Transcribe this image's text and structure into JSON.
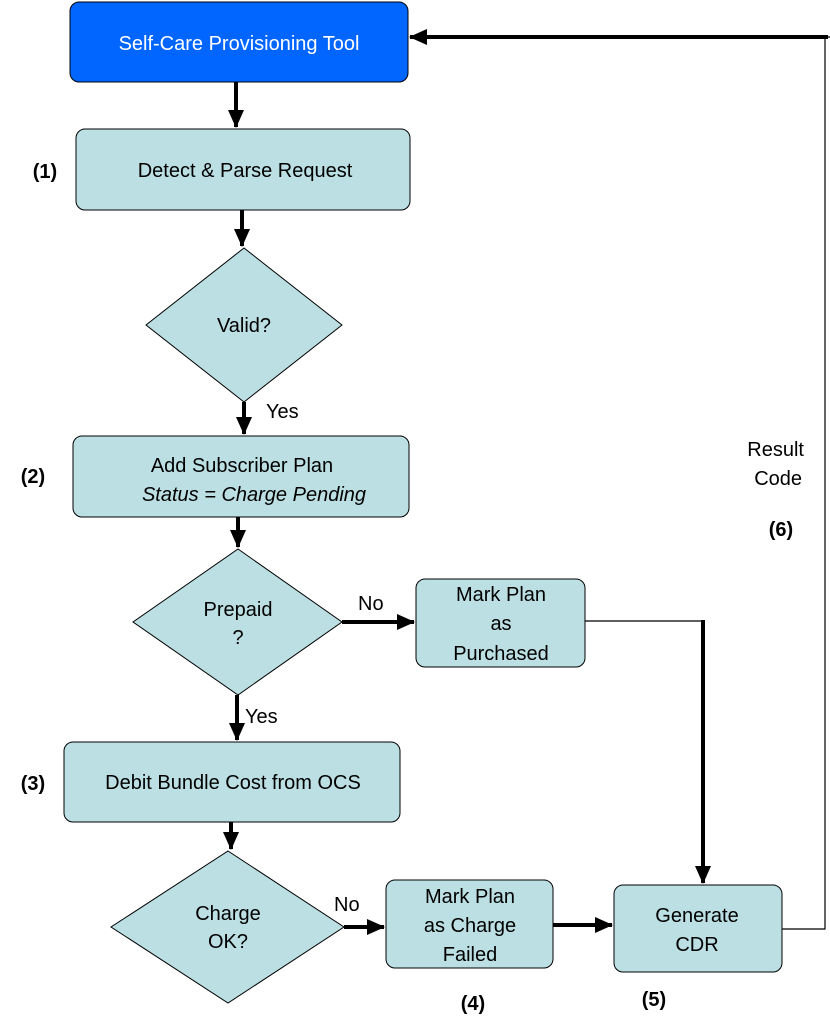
{
  "diagram": {
    "colors": {
      "start_fill": "#0066FF",
      "node_fill": "#BBDFE3",
      "line": "#000000",
      "text": "#000000",
      "start_text": "#FFFFFF"
    },
    "nodes": {
      "start": {
        "label": "Self-Care Provisioning Tool"
      },
      "detect": {
        "label": "Detect & Parse Request",
        "step": "(1)"
      },
      "valid": {
        "label": "Valid?"
      },
      "add_plan": {
        "line1": "Add Subscriber Plan",
        "line2": "Status = Charge Pending",
        "step": "(2)"
      },
      "prepaid": {
        "line1": "Prepaid",
        "line2": "?"
      },
      "purchased": {
        "line1": "Mark Plan",
        "line2": "as",
        "line3": "Purchased"
      },
      "debit": {
        "label": "Debit Bundle Cost from OCS",
        "step": "(3)"
      },
      "charge_ok": {
        "line1": "Charge",
        "line2": "OK?"
      },
      "charge_failed": {
        "line1": "Mark Plan",
        "line2": "as Charge",
        "line3": "Failed",
        "step": "(4)"
      },
      "cdr": {
        "line1": "Generate",
        "line2": "CDR",
        "step": "(5)"
      }
    },
    "edge_labels": {
      "valid_yes": "Yes",
      "prepaid_no": "No",
      "prepaid_yes": "Yes",
      "charge_no": "No",
      "result_line1": "Result",
      "result_line2": "Code",
      "result_step": "(6)"
    }
  }
}
